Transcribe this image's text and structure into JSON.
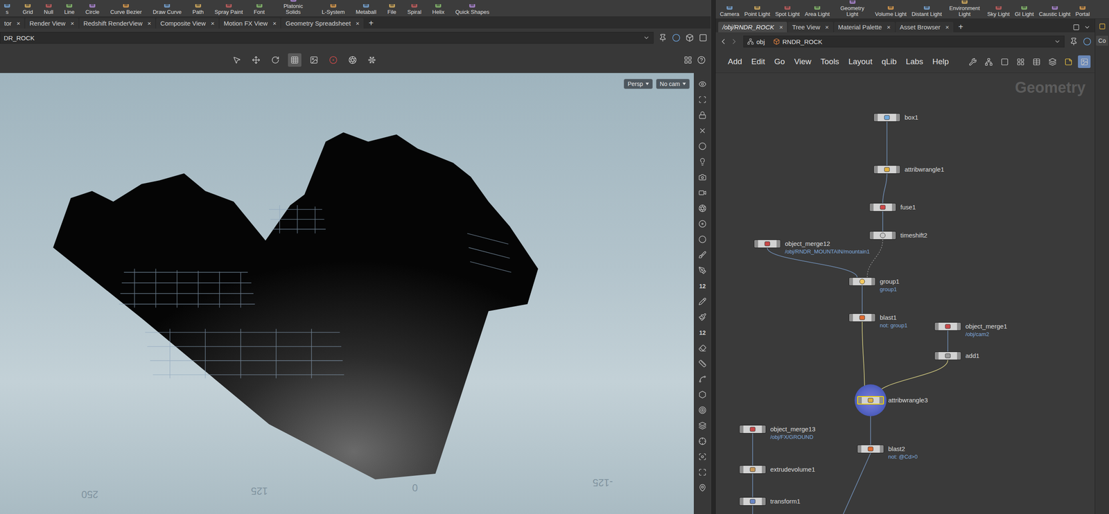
{
  "shelf_left": [
    "s",
    "Grid",
    "Null",
    "Line",
    "Circle",
    "Curve Bezier",
    "Draw Curve",
    "Path",
    "Spray Paint",
    "Font",
    "Platonic Solids",
    "L-System",
    "Metaball",
    "File",
    "Spiral",
    "Helix",
    "Quick Shapes"
  ],
  "shelf_right": [
    "Camera",
    "Point Light",
    "Spot Light",
    "Area Light",
    "Geometry Light",
    "Volume Light",
    "Distant Light",
    "Environment Light",
    "Sky Light",
    "GI Light",
    "Caustic Light",
    "Portal"
  ],
  "tab_close": "×",
  "tab_add": "+",
  "viewer": {
    "tabs": [
      {
        "label": "tor",
        "selected": false
      },
      {
        "label": "Render View",
        "selected": false
      },
      {
        "label": "Redshift RenderView",
        "selected": false
      },
      {
        "label": "Composite View",
        "selected": false
      },
      {
        "label": "Motion FX View",
        "selected": false
      },
      {
        "label": "Geometry Spreadsheet",
        "selected": false
      }
    ],
    "path": "DR_ROCK",
    "view_menus": [
      "Persp",
      "No cam"
    ],
    "grid_labels": [
      "250",
      "125",
      "0",
      "-125"
    ],
    "tool_labels": [
      "12",
      "12"
    ]
  },
  "network": {
    "tabs": [
      {
        "label": "/obj/RNDR_ROCK",
        "selected": true
      },
      {
        "label": "Tree View",
        "selected": false
      },
      {
        "label": "Material Palette",
        "selected": false
      },
      {
        "label": "Asset Browser",
        "selected": false
      }
    ],
    "path": [
      "obj",
      "RNDR_ROCK"
    ],
    "menu": [
      "Add",
      "Edit",
      "Go",
      "View",
      "Tools",
      "Layout",
      "qLib",
      "Labs",
      "Help"
    ],
    "context": "Geometry",
    "nodes": [
      {
        "name": "box1",
        "kind": "box",
        "selected": false
      },
      {
        "name": "attribwrangle1",
        "kind": "wrangle",
        "selected": false
      },
      {
        "name": "fuse1",
        "kind": "fuse",
        "selected": false
      },
      {
        "name": "timeshift2",
        "kind": "timeshift",
        "selected": false
      },
      {
        "name": "object_merge12",
        "kind": "merge",
        "sub": "/obj/RNDR_MOUNTAIN/mountain1",
        "selected": false
      },
      {
        "name": "group1",
        "kind": "group",
        "sub": "group1",
        "selected": false
      },
      {
        "name": "blast1",
        "kind": "blast",
        "sub": "not: group1",
        "selected": false
      },
      {
        "name": "object_merge1",
        "kind": "merge",
        "sub": "/obj/cam2",
        "selected": false
      },
      {
        "name": "add1",
        "kind": "add",
        "selected": false
      },
      {
        "name": "attribwrangle3",
        "kind": "wrangle",
        "selected": true
      },
      {
        "name": "object_merge13",
        "kind": "merge",
        "sub": "/obj/FX/GROUND",
        "selected": false
      },
      {
        "name": "blast2",
        "kind": "blast",
        "sub": "not: @Cd>0",
        "selected": false
      },
      {
        "name": "extrudevolume1",
        "kind": "extrude",
        "selected": false
      },
      {
        "name": "transform1",
        "kind": "transform",
        "selected": false
      }
    ]
  },
  "side_panel": {
    "tab": "Co"
  }
}
